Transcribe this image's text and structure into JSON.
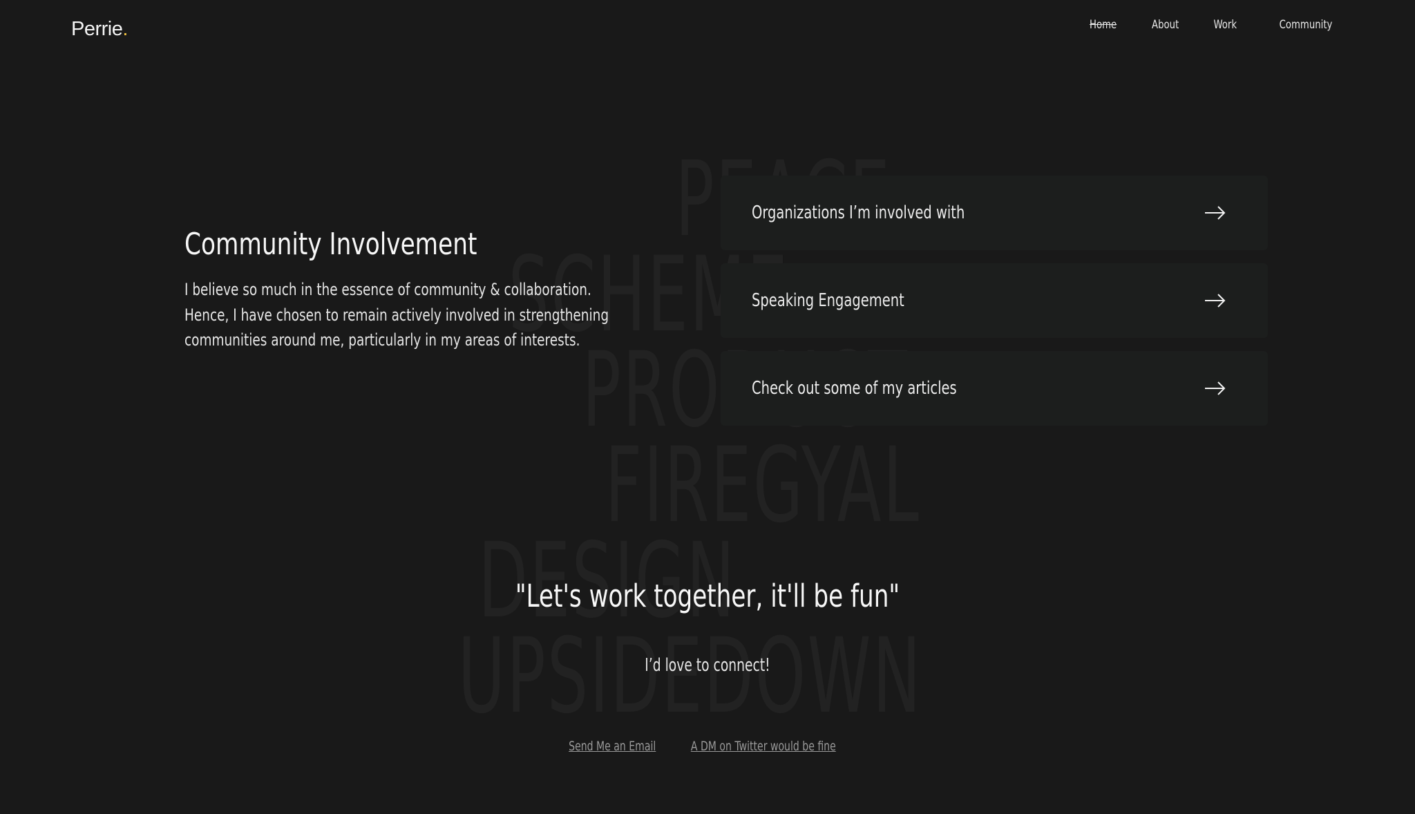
{
  "header": {
    "logo_text": "Perrie",
    "logo_dot": ".",
    "nav": [
      {
        "label": "Home"
      },
      {
        "label": "About"
      },
      {
        "label": "Work"
      },
      {
        "label": "Community"
      }
    ]
  },
  "background_words": [
    "PEACE",
    "SCHEME",
    "PRODUCT",
    "FIREGYAL",
    "DESIGN",
    "UPSIDEDOWN"
  ],
  "intro": {
    "title": "Community Involvement",
    "body": "I believe so much in the essence of community & collaboration. Hence, I have chosen to remain actively involved in strengthening communities around me, particularly in my areas of interests."
  },
  "cards": [
    {
      "label": "Organizations I’m involved with",
      "icon": "arrow-right-icon"
    },
    {
      "label": "Speaking Engagement",
      "icon": "arrow-right-icon"
    },
    {
      "label": "Check out some of my articles",
      "icon": "arrow-right-icon"
    }
  ],
  "cta": {
    "quote": "\"Let's work together, it'll be fun\"",
    "subtitle": "I’d love to connect!",
    "links": [
      {
        "label": "Send Me an Email"
      },
      {
        "label": "A DM on Twitter would be fine"
      }
    ]
  },
  "colors": {
    "background": "#191919",
    "card": "#1c1e1d",
    "accent_dot": "#f4c542",
    "muted_link": "#9a9a9a"
  }
}
